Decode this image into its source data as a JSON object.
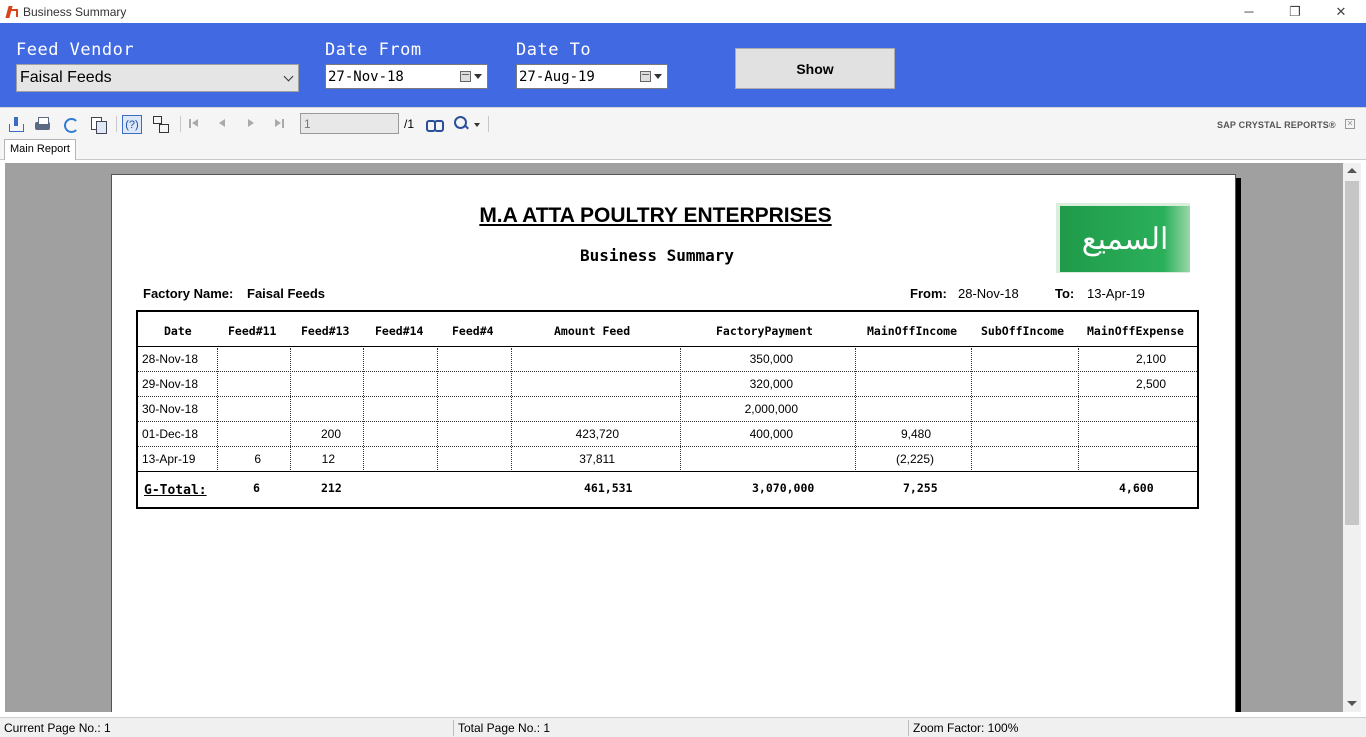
{
  "window": {
    "title": "Business Summary",
    "minimize_glyph": "─",
    "maximize_glyph": "❐",
    "close_glyph": "✕"
  },
  "filters": {
    "vendor_label": "Feed Vendor",
    "vendor_value": "Faisal Feeds",
    "date_from_label": "Date From",
    "date_from_value": "27-Nov-18",
    "date_to_label": "Date To",
    "date_to_value": "27-Aug-19",
    "show_label": "Show"
  },
  "viewer_toolbar": {
    "icons": [
      "export-icon",
      "print-icon",
      "refresh-icon",
      "copy-icon",
      "help-icon",
      "group-tree-icon",
      "first-page-icon",
      "previous-page-icon",
      "next-page-icon",
      "last-page-icon",
      "find-icon",
      "zoom-icon"
    ],
    "page_input_value": "1",
    "page_total": "/1",
    "brand": "SAP CRYSTAL REPORTS®",
    "close_glyph": "✕"
  },
  "tabs": [
    {
      "label": "Main Report"
    }
  ],
  "report": {
    "company": "M.A ATTA POULTRY ENTERPRISES",
    "title": "Business Summary",
    "logo_text": "السميع",
    "factory_label": "Factory Name:",
    "factory_value": "Faisal Feeds",
    "from_label": "From:",
    "from_value": "28-Nov-18",
    "to_label": "To:",
    "to_value": "13-Apr-19",
    "columns": [
      "Date",
      "Feed#11",
      "Feed#13",
      "Feed#14",
      "Feed#4",
      "Amount Feed",
      "FactoryPayment",
      "MainOffIncome",
      "SubOffIncome",
      "MainOffExpense"
    ],
    "rows": [
      [
        "28-Nov-18",
        "",
        "",
        "",
        "",
        "",
        "350,000",
        "",
        "",
        "2,100"
      ],
      [
        "29-Nov-18",
        "",
        "",
        "",
        "",
        "",
        "320,000",
        "",
        "",
        "2,500"
      ],
      [
        "30-Nov-18",
        "",
        "",
        "",
        "",
        "",
        "2,000,000",
        "",
        "",
        ""
      ],
      [
        "01-Dec-18",
        "",
        "200",
        "",
        "",
        "423,720",
        "400,000",
        "9,480",
        "",
        ""
      ],
      [
        "13-Apr-19",
        "6",
        "12",
        "",
        "",
        "37,811",
        "",
        "(2,225)",
        "",
        ""
      ]
    ],
    "total_label": "G-Total:",
    "totals": [
      "6",
      "212",
      "",
      "",
      "461,531",
      "3,070,000",
      "7,255",
      "",
      "4,600"
    ]
  },
  "status": {
    "current_page": "Current Page No.: 1",
    "total_pages": "Total Page No.: 1",
    "zoom": "Zoom Factor: 100%"
  },
  "colors": {
    "header_bg": "#4169e1",
    "logo_green": "#1f9a4a"
  }
}
